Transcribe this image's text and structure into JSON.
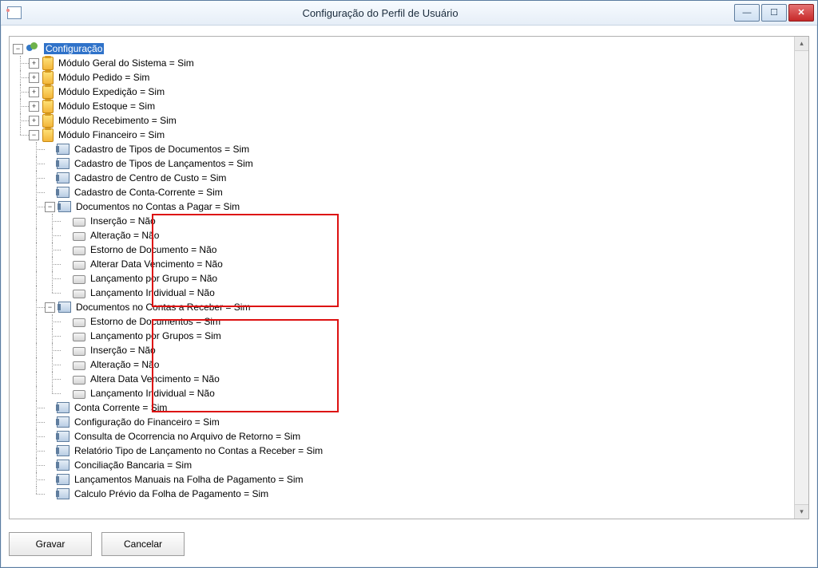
{
  "window": {
    "title": "Configuração do Perfil de Usuário"
  },
  "buttons": {
    "save": "Gravar",
    "cancel": "Cancelar"
  },
  "toggle": {
    "plus": "+",
    "minus": "−"
  },
  "tree": {
    "root": "Configuração",
    "modules": [
      {
        "label": "Módulo Geral do Sistema = Sim",
        "expanded": false
      },
      {
        "label": "Módulo Pedido  = Sim",
        "expanded": false
      },
      {
        "label": "Módulo Expedição  = Sim",
        "expanded": false
      },
      {
        "label": "Módulo Estoque  = Sim",
        "expanded": false
      },
      {
        "label": "Módulo Recebimento  = Sim",
        "expanded": false
      },
      {
        "label": "Módulo Financeiro  = Sim",
        "expanded": true,
        "children": [
          {
            "icon": "doc",
            "label": "Cadastro de Tipos de Documentos = Sim"
          },
          {
            "icon": "doc",
            "label": "Cadastro de Tipos de Lançamentos = Sim"
          },
          {
            "icon": "doc",
            "label": "Cadastro de Centro de Custo = Sim"
          },
          {
            "icon": "doc",
            "label": "Cadastro de Conta-Corrente = Sim"
          },
          {
            "icon": "doc",
            "label": "Documentos no Contas a Pagar = Sim",
            "expanded": true,
            "highlight": 1,
            "children": [
              {
                "icon": "leaf",
                "label": "Inserção = Não"
              },
              {
                "icon": "leaf",
                "label": "Alteração = Não"
              },
              {
                "icon": "leaf",
                "label": "Estorno de Documento = Não"
              },
              {
                "icon": "leaf",
                "label": "Alterar Data Vencimento = Não"
              },
              {
                "icon": "leaf",
                "label": "Lançamento por Grupo = Não"
              },
              {
                "icon": "leaf",
                "label": "Lançamento Individual = Não"
              }
            ]
          },
          {
            "icon": "doc",
            "label": "Documentos no Contas a Receber = Sim",
            "expanded": true,
            "highlight": 2,
            "children": [
              {
                "icon": "leaf",
                "label": "Estorno de Documentos = Sim"
              },
              {
                "icon": "leaf",
                "label": "Lançamento por Grupos = Sim"
              },
              {
                "icon": "leaf",
                "label": "Inserção = Não"
              },
              {
                "icon": "leaf",
                "label": "Alteração = Não"
              },
              {
                "icon": "leaf",
                "label": "Altera Data Vencimento = Não"
              },
              {
                "icon": "leaf",
                "label": "Lançamento Individual = Não"
              }
            ]
          },
          {
            "icon": "doc",
            "label": "Conta Corrente = Sim"
          },
          {
            "icon": "doc",
            "label": "Configuração do Financeiro = Sim"
          },
          {
            "icon": "doc",
            "label": "Consulta de Ocorrencia no Arquivo de Retorno = Sim"
          },
          {
            "icon": "doc",
            "label": "Relatório Tipo de Lançamento no Contas a Receber = Sim"
          },
          {
            "icon": "doc",
            "label": "Conciliação Bancaria = Sim"
          },
          {
            "icon": "doc",
            "label": "Lançamentos Manuais na Folha de Pagamento = Sim"
          },
          {
            "icon": "doc",
            "label": "Calculo Prévio da Folha de Pagamento = Sim"
          }
        ]
      }
    ]
  }
}
